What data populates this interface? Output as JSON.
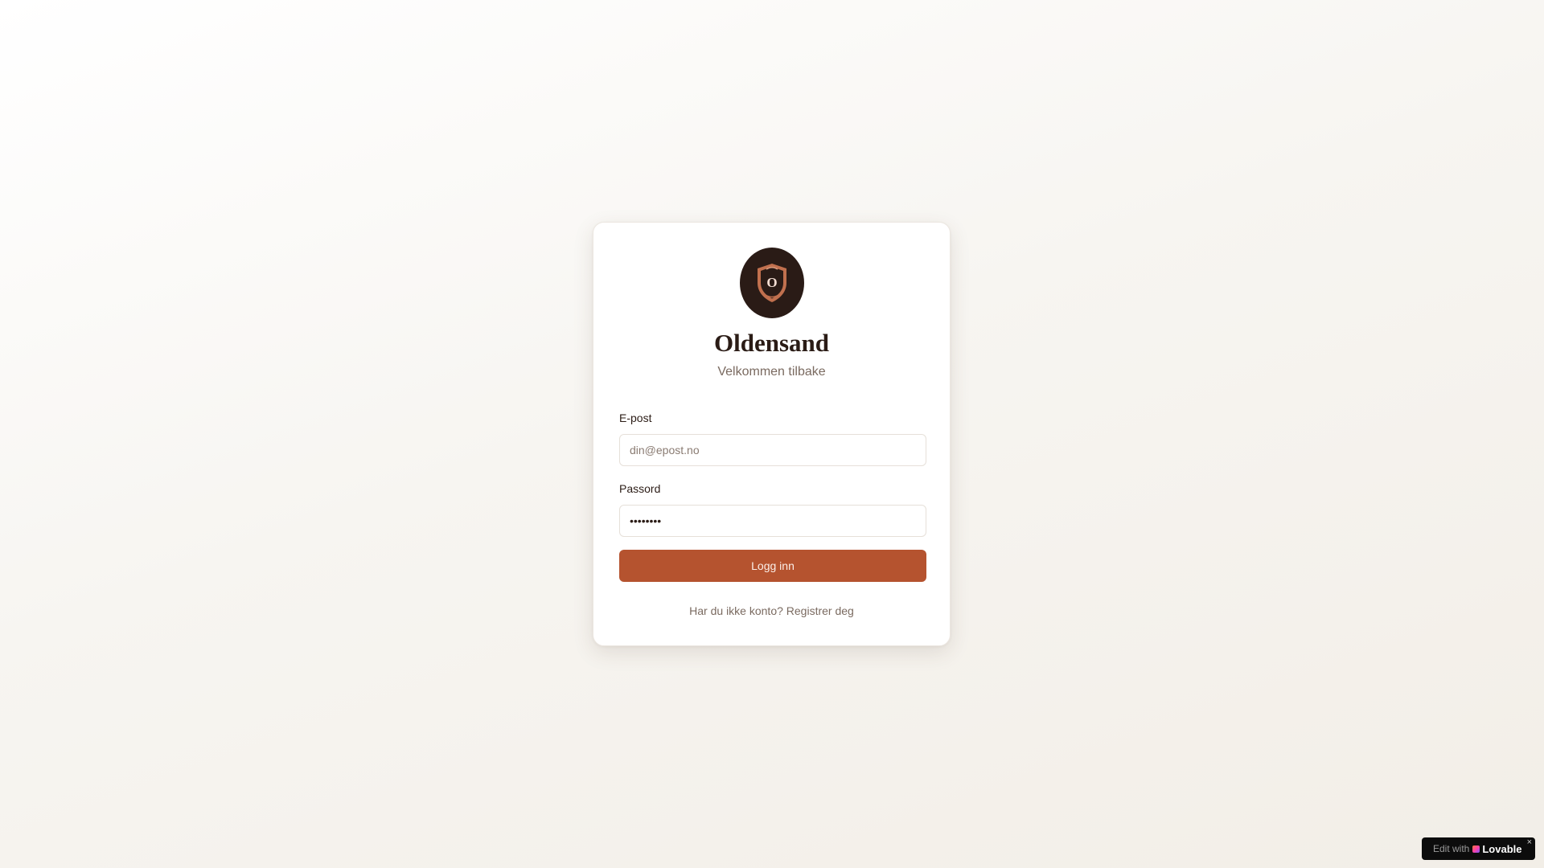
{
  "brand": {
    "name": "Oldensand",
    "logo_letter": "O",
    "subtitle": "Velkommen tilbake"
  },
  "form": {
    "email_label": "E-post",
    "email_placeholder": "din@epost.no",
    "email_value": "",
    "password_label": "Passord",
    "password_value": "••••••••",
    "submit_label": "Logg inn"
  },
  "register": {
    "prompt": "Har du ikke konto?",
    "link": "Registrer deg"
  },
  "badge": {
    "prefix": "Edit with",
    "name": "Lovable",
    "close": "×"
  },
  "colors": {
    "primary": "#b5532f",
    "logo_bg": "#2a1b16",
    "shield": "#c1704e",
    "text": "#2b1c16",
    "muted": "#7a6a60"
  }
}
